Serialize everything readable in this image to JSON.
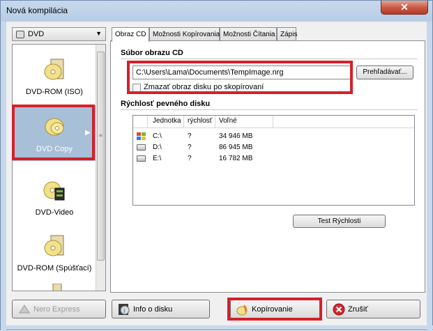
{
  "window": {
    "title": "Nová kompilácia",
    "close_glyph": "✕"
  },
  "dropdown": {
    "value": "DVD"
  },
  "sidebar": {
    "items": [
      {
        "label": "DVD-ROM (ISO)",
        "icon": "disc-icon"
      },
      {
        "label": "DVD Copy",
        "icon": "disc-copy-icon",
        "selected": true
      },
      {
        "label": "DVD-Video",
        "icon": "dvd-video-icon"
      },
      {
        "label": "DVD-ROM (Spúšťací)",
        "icon": "boot-disc-icon"
      }
    ]
  },
  "tabs": [
    {
      "label": "Obraz CD"
    },
    {
      "label": "Možnosti Kopírovania"
    },
    {
      "label": "Možnosti Čítania"
    },
    {
      "label": "Zápis"
    }
  ],
  "image_section": {
    "title": "Súbor obrazu CD",
    "path": "C:\\Users\\Lama\\Documents\\TempImage.nrg",
    "browse_label": "Prehľadávať...",
    "delete_checkbox_label": "Zmazať obraz disku po skopírovaní",
    "delete_checked": false
  },
  "speed_section": {
    "title": "Rýchlosť pevného disku",
    "columns": [
      "Jednotka",
      "rýchlosť",
      "Voľné"
    ],
    "rows": [
      {
        "unit": "C:\\",
        "speed": "?",
        "free": "34 946 MB"
      },
      {
        "unit": "D:\\",
        "speed": "?",
        "free": "86 945 MB"
      },
      {
        "unit": "E:\\",
        "speed": "?",
        "free": "16 782 MB"
      }
    ],
    "test_label": "Test Rýchlosti"
  },
  "buttons": {
    "nero_express": "Nero Express",
    "disc_info": "Info o disku",
    "copy": "Kopírovanie",
    "cancel": "Zrušiť"
  },
  "colors": {
    "highlight": "#d4202a",
    "selected_bg": "#a8bfd8"
  }
}
